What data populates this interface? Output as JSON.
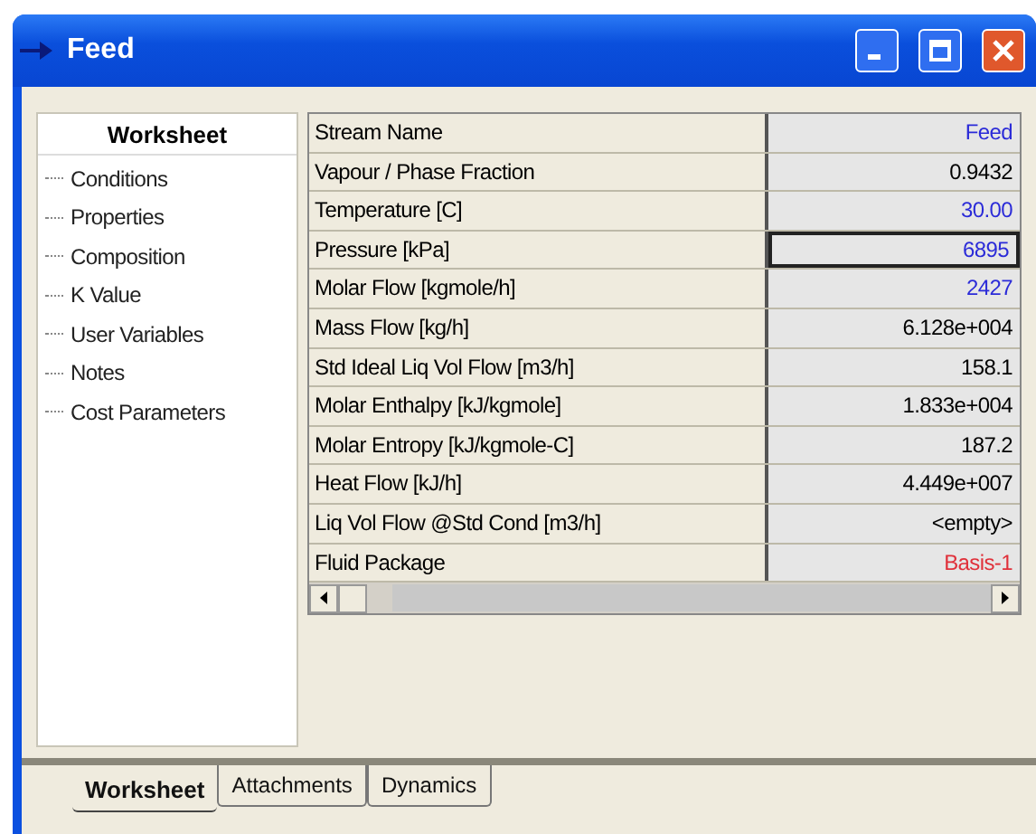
{
  "window": {
    "title": "Feed"
  },
  "sidebar": {
    "heading": "Worksheet",
    "items": [
      {
        "label": "Conditions"
      },
      {
        "label": "Properties"
      },
      {
        "label": "Composition"
      },
      {
        "label": "K Value"
      },
      {
        "label": "User Variables"
      },
      {
        "label": "Notes"
      },
      {
        "label": "Cost Parameters"
      }
    ]
  },
  "table": {
    "rows": [
      {
        "name": "Stream Name",
        "value": "Feed",
        "color": "#2b2bd8",
        "selected": false
      },
      {
        "name": "Vapour / Phase Fraction",
        "value": "0.9432",
        "color": "#000000",
        "selected": false
      },
      {
        "name": "Temperature [C]",
        "value": "30.00",
        "color": "#2b2bd8",
        "selected": false
      },
      {
        "name": "Pressure [kPa]",
        "value": "6895",
        "color": "#2b2bd8",
        "selected": true
      },
      {
        "name": "Molar Flow [kgmole/h]",
        "value": "2427",
        "color": "#2b2bd8",
        "selected": false
      },
      {
        "name": "Mass Flow [kg/h]",
        "value": "6.128e+004",
        "color": "#000000",
        "selected": false
      },
      {
        "name": "Std Ideal Liq Vol Flow [m3/h]",
        "value": "158.1",
        "color": "#000000",
        "selected": false
      },
      {
        "name": "Molar Enthalpy [kJ/kgmole]",
        "value": "1.833e+004",
        "color": "#000000",
        "selected": false
      },
      {
        "name": "Molar Entropy [kJ/kgmole-C]",
        "value": "187.2",
        "color": "#000000",
        "selected": false
      },
      {
        "name": "Heat Flow [kJ/h]",
        "value": "4.449e+007",
        "color": "#000000",
        "selected": false
      },
      {
        "name": "Liq Vol Flow @Std Cond [m3/h]",
        "value": "<empty>",
        "color": "#000000",
        "selected": false
      },
      {
        "name": "Fluid Package",
        "value": "Basis-1",
        "color": "#e0303a",
        "selected": false
      }
    ]
  },
  "tabs": [
    {
      "label": "Worksheet",
      "selected": true
    },
    {
      "label": "Attachments",
      "selected": false
    },
    {
      "label": "Dynamics",
      "selected": false
    }
  ]
}
